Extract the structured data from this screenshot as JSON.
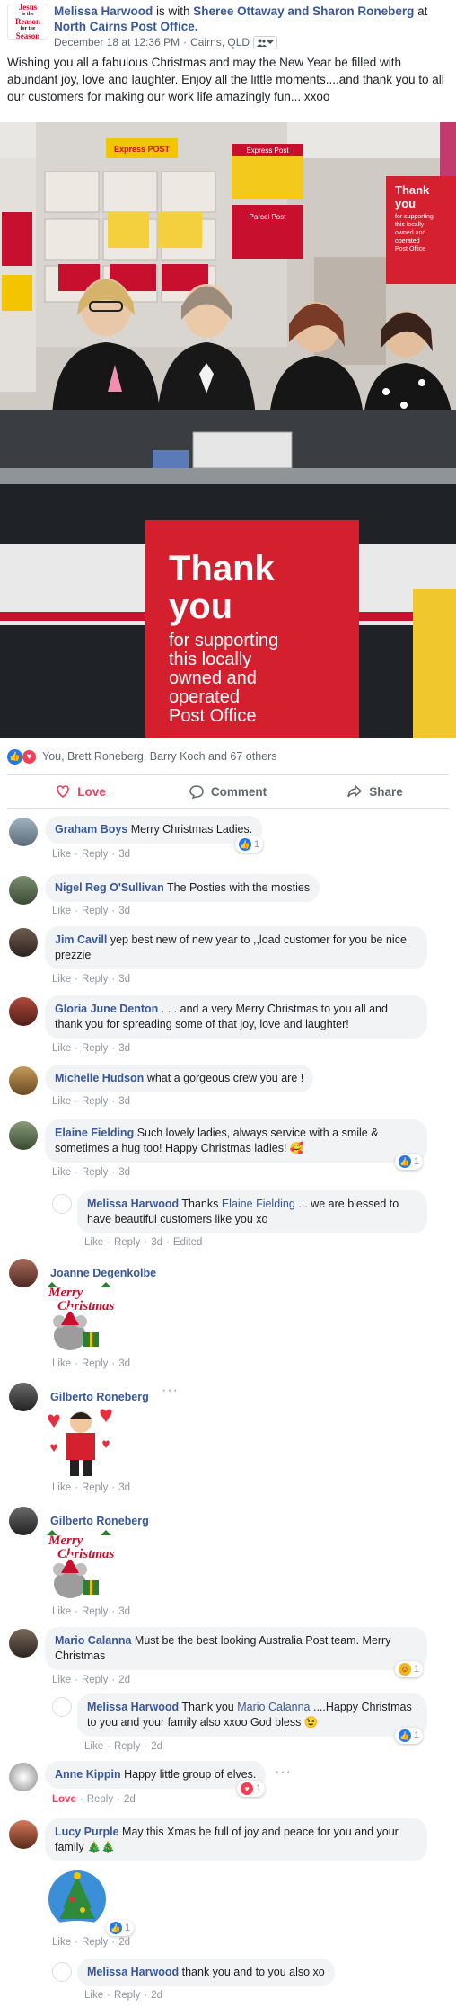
{
  "post": {
    "author": "Melissa Harwood",
    "with_text": " is with ",
    "tagged": "Sheree Ottaway and Sharon Roneberg",
    "at_text": " at ",
    "location": "North Cairns Post Office.",
    "timestamp": "December 18 at 12:36 PM",
    "place": "Cairns, QLD",
    "logo_lines": [
      "Jesus",
      "is the",
      "Reason",
      "for the",
      "Season"
    ],
    "body": "Wishing you all a fabulous Christmas and may the New Year be filled with abundant joy, love and laughter. Enjoy all the little moments....and thank you to all our customers for making our work life amazingly fun... xxoo"
  },
  "photo": {
    "sign_express": "Express POST",
    "sign_express2": "Express Post",
    "sign_parcel": "Parcel Post",
    "sign_thank_small": [
      "Thank",
      "you"
    ],
    "sign_thank_small_sub": [
      "for supporting",
      "this locally",
      "owned and",
      "operated",
      "Post Office"
    ],
    "sign_thank_big": [
      "Thank",
      "you"
    ],
    "sign_thank_big_sub": [
      "for supporting",
      "this locally",
      "owned and",
      "operated",
      "Post Office"
    ]
  },
  "reactions": {
    "summary": "You, Brett Roneberg, Barry Koch and 67 others"
  },
  "actions": {
    "love": "Love",
    "comment": "Comment",
    "share": "Share"
  },
  "meta_labels": {
    "like": "Like",
    "reply": "Reply",
    "love": "Love",
    "edited": "Edited",
    "sep": "·"
  },
  "comments": [
    {
      "name": "Graham Boys",
      "text": "Merry Christmas Ladies.",
      "time": "3d",
      "reaction_count": "1"
    },
    {
      "name": "Nigel Reg O'Sullivan",
      "text": "The Posties with the mosties",
      "time": "3d"
    },
    {
      "name": "Jim Cavill",
      "text": "yep best new of new year to ,,load customer for you be nice prezzie",
      "time": "3d"
    },
    {
      "name": "Gloria June Denton",
      "text": ". . . and a very Merry Christmas to you all and thank you for spreading some of that joy, love and laughter!",
      "time": "3d"
    },
    {
      "name": "Michelle Hudson",
      "text": "what a gorgeous crew you are !",
      "time": "3d"
    },
    {
      "name": "Elaine Fielding",
      "text": "Such lovely ladies, always service with a smile & sometimes a hug too! Happy Christmas ladies! 🥰",
      "time": "3d",
      "reaction_count": "1"
    },
    {
      "name": "Melissa Harwood",
      "text_before": "Thanks ",
      "mention": "Elaine Fielding",
      "text": " ... we are blessed to have beautiful customers like you xo",
      "time": "3d"
    },
    {
      "name": "Joanne Degenkolbe",
      "sticker_text": [
        "Merry",
        "Christmas"
      ],
      "time": "3d"
    },
    {
      "name": "Gilberto Roneberg",
      "time": "3d"
    },
    {
      "name": "Gilberto Roneberg",
      "sticker_text": [
        "Merry",
        "Christmas"
      ],
      "time": "3d"
    },
    {
      "name": "Mario Calanna",
      "text": "Must be the best looking Australia Post team. Merry Christmas",
      "time": "2d",
      "reaction_count": "1"
    },
    {
      "name": "Melissa Harwood",
      "text_before": "Thank you ",
      "mention": "Mario Calanna",
      "text": " ....Happy Christmas to you and your family also xxoo God bless 😉",
      "time": "2d",
      "reaction_count": "1"
    },
    {
      "name": "Anne Kippin",
      "text": "Happy little group of elves.",
      "time": "2d",
      "reaction_count": "1"
    },
    {
      "name": "Lucy Purple",
      "text": "May this Xmas be full of joy and peace for you and your family 🎄🎄",
      "time": "2d",
      "reaction_count": "1"
    },
    {
      "name": "Melissa Harwood",
      "text": "thank you and to you also xo",
      "time": "2d"
    }
  ]
}
